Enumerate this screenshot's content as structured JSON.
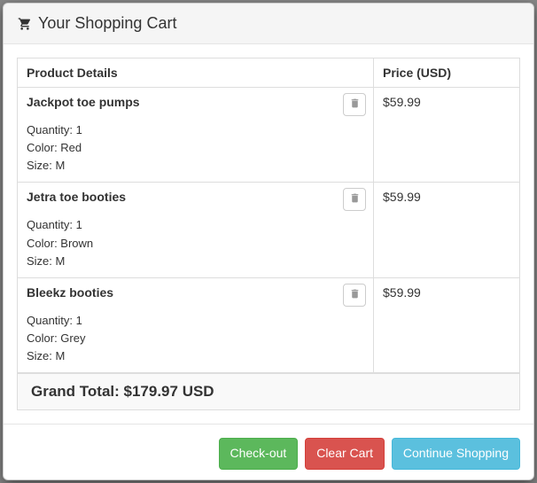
{
  "header": {
    "title": "Your Shopping Cart"
  },
  "table": {
    "headers": {
      "product": "Product Details",
      "price": "Price (USD)"
    },
    "labels": {
      "quantity": "Quantity: ",
      "color": "Color: ",
      "size": "Size: "
    },
    "items": [
      {
        "name": "Jackpot toe pumps",
        "quantity": "1",
        "color": "Red",
        "size": "M",
        "price": "$59.99"
      },
      {
        "name": "Jetra toe booties",
        "quantity": "1",
        "color": "Brown",
        "size": "M",
        "price": "$59.99"
      },
      {
        "name": "Bleekz booties",
        "quantity": "1",
        "color": "Grey",
        "size": "M",
        "price": "$59.99"
      }
    ]
  },
  "grand_total": {
    "label": "Grand Total: ",
    "value": "$179.97 USD"
  },
  "footer": {
    "checkout": "Check-out",
    "clear": "Clear Cart",
    "continue": "Continue Shopping"
  }
}
